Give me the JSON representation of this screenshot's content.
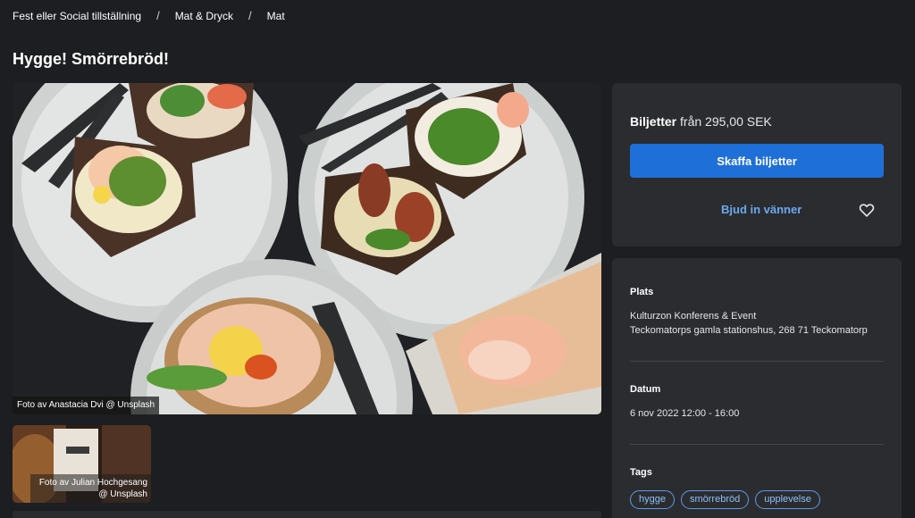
{
  "breadcrumb": {
    "items": [
      "Fest eller Social tillställning",
      "Mat & Dryck",
      "Mat"
    ],
    "separator": "/"
  },
  "page": {
    "title": "Hygge! Smörrebröd!"
  },
  "images": {
    "main_credit": "Foto av Anastacia Dvi @ Unsplash",
    "thumb_credit": "Foto av Julian Hochgesang @ Unsplash"
  },
  "tickets": {
    "label": "Biljetter",
    "price_text": "från 295,00 SEK",
    "buy_label": "Skaffa biljetter",
    "invite_label": "Bjud in vänner",
    "favorite_icon": "heart-icon"
  },
  "details": {
    "place_label": "Plats",
    "place_name": "Kulturzon Konferens & Event",
    "place_address": "Teckomatorps gamla stationshus, 268 71 Teckomatorp",
    "date_label": "Datum",
    "date_value": "6 nov 2022 12:00 - 16:00",
    "tags_label": "Tags",
    "tags": [
      "hygge",
      "smörrebröd",
      "upplevelse"
    ]
  },
  "colors": {
    "background": "#1d1e21",
    "card": "#2b2c30",
    "accent": "#1f6fd8",
    "link": "#6aa9f0"
  }
}
